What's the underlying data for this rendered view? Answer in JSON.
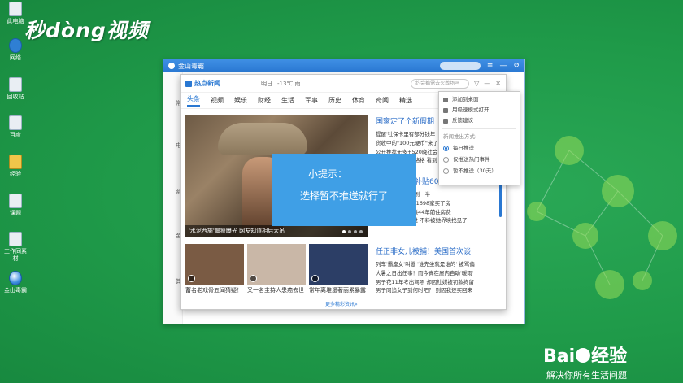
{
  "watermark": {
    "logo": "秒dòng视频"
  },
  "desktop_icons": [
    {
      "label": "此电脑",
      "kind": "pc-icon"
    },
    {
      "label": "网络",
      "kind": "network-icon"
    },
    {
      "label": "回收站",
      "kind": "recycle-bin-icon"
    },
    {
      "label": "百度",
      "kind": "document-icon"
    },
    {
      "label": "经验",
      "kind": "folder-icon"
    },
    {
      "label": "课题",
      "kind": "document-icon"
    },
    {
      "label": "工作同素材",
      "kind": "document-icon"
    },
    {
      "label": "金山毒霸",
      "kind": "antivirus-icon"
    }
  ],
  "outer_window": {
    "title": "金山毒霸",
    "side_labels": [
      "常",
      "电",
      "系",
      "金",
      "其"
    ],
    "controls": [
      "≡",
      "—",
      "↺"
    ]
  },
  "news_window": {
    "brand": "热点新闻",
    "date": "明日",
    "weather": "-13℃ 雨",
    "search_placeholder": "约会都需去火葬场吗",
    "controls": [
      "▽",
      "—",
      "✕"
    ],
    "tabs": [
      "头条",
      "视频",
      "娱乐",
      "财经",
      "生活",
      "军事",
      "历史",
      "体育",
      "奇闻",
      "精选"
    ],
    "active_tab": "头条",
    "hero_caption": "'水泥西施'偏瘦曝光 网友知道相后大吊",
    "thumbs": [
      {
        "title": "蓄名老戏骨五闻猜疑！",
        "color": "#7a5b44"
      },
      {
        "title": "又一名主持人患癌去世",
        "color": "#c9b7a7"
      },
      {
        "title": "常年离堆湿著丽累暴露",
        "color": "#2c3e66"
      },
      {
        "title": "斯琴高娃遭家暴？",
        "color": "#8d6e59"
      }
    ],
    "more": "更多精彩资讯»",
    "news_blocks": [
      {
        "headline": "国家定了个新假期",
        "lines": [
          "提醒'社保卡里有部分钱年",
          "货收中的\"100元硬币\"来了",
          "公开推荐无多+520晚社会",
          "一出租宋马苦 太格格 看到"
        ]
      },
      {
        "headline": "来了:这笔大补贴6000!",
        "lines": [
          "世界第一 美国不到一半",
          "家金会都哪儿了71698家买了房",
          "家在美育交宗补偿44年前住房费",
          "夫妻逼剛照片包过 不料被她界境找见了"
        ]
      },
      {
        "headline": "任正非女儿被捕！美国首次谈",
        "lines": [
          "列车'霸座女'叫嚣 '谁先坐就是谁的' 被骂偏",
          "大暑之日出任事！而今真在屋内自助'暖雨'",
          "男子花11年考出驾照 却因社媒被罚款拘留",
          "男子同追女子到何时吧？ 则因我还买回来"
        ]
      }
    ]
  },
  "dropdown_menu": {
    "items": [
      {
        "label": "添加到桌面",
        "icon": "desktop-icon"
      },
      {
        "label": "用极速模式打开",
        "icon": "browser-icon"
      },
      {
        "label": "反馈建议",
        "icon": "feedback-icon"
      }
    ],
    "section_title": "新闻推出方式:",
    "options": [
      {
        "label": "每日推送",
        "selected": true
      },
      {
        "label": "仅推送热门事件",
        "selected": false
      },
      {
        "label": "暂不推送（30天）",
        "selected": false
      }
    ]
  },
  "tip": {
    "title": "小提示：",
    "body": "选择暂不推送就行了"
  },
  "footer_brand": {
    "name_left": "Bai",
    "name_right": "经验",
    "slogan": "解决你所有生活问题"
  },
  "colors": {
    "desktop": "#1f9a49",
    "accent": "#2a78d2",
    "tip": "#3f9fe6"
  }
}
